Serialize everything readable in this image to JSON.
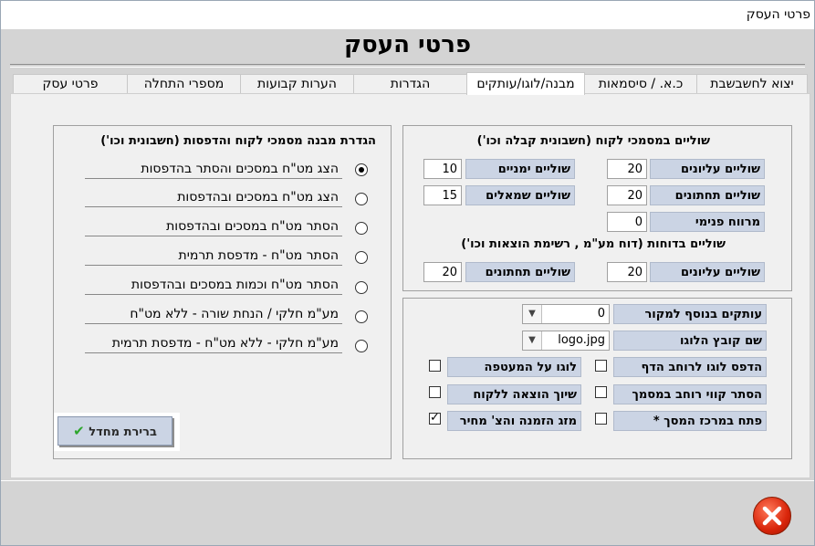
{
  "window": {
    "title": "פרטי העסק"
  },
  "header": {
    "title": "פרטי העסק"
  },
  "tabs": [
    {
      "label": "יצוא לחשבשבת"
    },
    {
      "label": "כ.א. / סיסמאות"
    },
    {
      "label": "מבנה/לוגו/עותקים"
    },
    {
      "label": "הגדרות"
    },
    {
      "label": "הערות קבועות"
    },
    {
      "label": "מספרי התחלה"
    },
    {
      "label": "פרטי עסק"
    }
  ],
  "margins": {
    "title": "שוליים במסמכי לקוח (חשבונית קבלה וכו')",
    "top_label": "שוליים עליונים",
    "top_value": "20",
    "right_label": "שוליים ימניים",
    "right_value": "10",
    "bottom_label": "שוליים תחתונים",
    "bottom_value": "20",
    "left_label": "שוליים שמאלים",
    "left_value": "15",
    "inner_label": "מרווח פנימי",
    "inner_value": "0",
    "reports_title": "שוליים בדוחות (דוח מע\"מ , רשימת הוצאות וכו')",
    "reports_top_label": "שוליים עליונים",
    "reports_top_value": "20",
    "reports_bottom_label": "שוליים תחתונים",
    "reports_bottom_value": "20"
  },
  "options": {
    "copies_label": "עותקים בנוסף למקור",
    "copies_value": "0",
    "logo_label": "שם קובץ הלוגו",
    "logo_value": "logo.jpg",
    "print_logo_label": "הדפס לוגו לרוחב הדף",
    "logo_envelope_label": "לוגו על המעטפה",
    "hide_lines_label": "הסתר קווי רוחב במסמך",
    "assign_expense_label": "שיוך הוצאה ללקוח",
    "center_label": "פתח במרכז המסך *",
    "merge_label": "מזג הזמנה והצ' מחיר"
  },
  "structure": {
    "title": "הגדרת מבנה מסמכי לקוח והדפסות (חשבונית וכו')",
    "items": [
      {
        "label": "הצג מט\"ח במסכים והסתר בהדפסות"
      },
      {
        "label": "הצג מט\"ח במסכים ובהדפסות"
      },
      {
        "label": "הסתר מט\"ח במסכים ובהדפסות"
      },
      {
        "label": "הסתר מט\"ח - מדפסת תרמית"
      },
      {
        "label": "הסתר מט\"ח וכמות במסכים ובהדפסות"
      },
      {
        "label": "מע\"מ חלקי / הנחת שורה - ללא מט\"ח"
      },
      {
        "label": "מע\"מ חלקי - ללא מט\"ח - מדפסת תרמית"
      }
    ],
    "default_button": "ברירת מחדל"
  }
}
